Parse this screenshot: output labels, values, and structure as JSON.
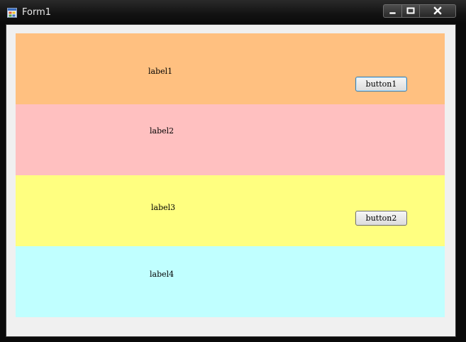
{
  "window": {
    "title": "Form1"
  },
  "panels": [
    {
      "color": "#ffc080",
      "label": "label1",
      "button": "button1"
    },
    {
      "color": "#ffc0c0",
      "label": "label2"
    },
    {
      "color": "#ffff80",
      "label": "label3",
      "button": "button2"
    },
    {
      "color": "#c0ffff",
      "label": "label4"
    }
  ],
  "icons": {
    "app": "form-icon",
    "minimize": "minimize-icon",
    "maximize": "maximize-icon",
    "close": "close-icon"
  }
}
